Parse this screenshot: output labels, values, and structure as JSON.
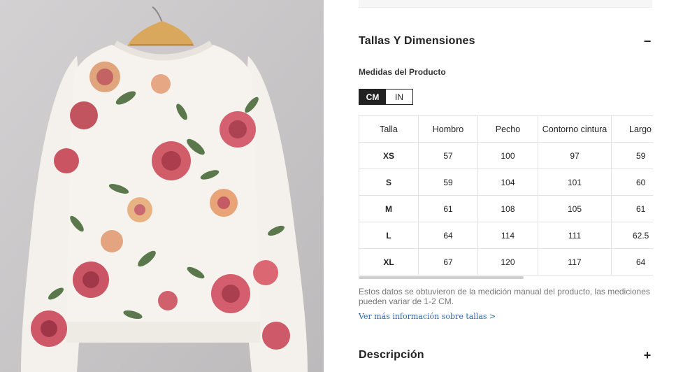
{
  "colors": {
    "accent": "#222222",
    "link": "#2b63a8",
    "note": "#777777",
    "image_bg": "#c9c7c8"
  },
  "product_image": {
    "alt": "floral-print-sweatshirt"
  },
  "size_section": {
    "title": "Tallas Y Dimensiones",
    "toggle": "−",
    "subtitle": "Medidas del Producto",
    "units": {
      "active": "CM",
      "inactive": "IN"
    },
    "table": {
      "headers": [
        "Talla",
        "Hombro",
        "Pecho",
        "Contorno cintura",
        "Largo"
      ],
      "rows": [
        [
          "XS",
          "57",
          "100",
          "97",
          "59"
        ],
        [
          "S",
          "59",
          "104",
          "101",
          "60"
        ],
        [
          "M",
          "61",
          "108",
          "105",
          "61"
        ],
        [
          "L",
          "64",
          "114",
          "111",
          "62.5"
        ],
        [
          "XL",
          "67",
          "120",
          "117",
          "64"
        ]
      ]
    },
    "note": "Estos datos se obtuvieron de la medición manual del producto, las mediciones pueden variar de 1-2 CM.",
    "more_link": "Ver más información sobre tallas >"
  },
  "description_section": {
    "title": "Descripción",
    "toggle": "+"
  }
}
